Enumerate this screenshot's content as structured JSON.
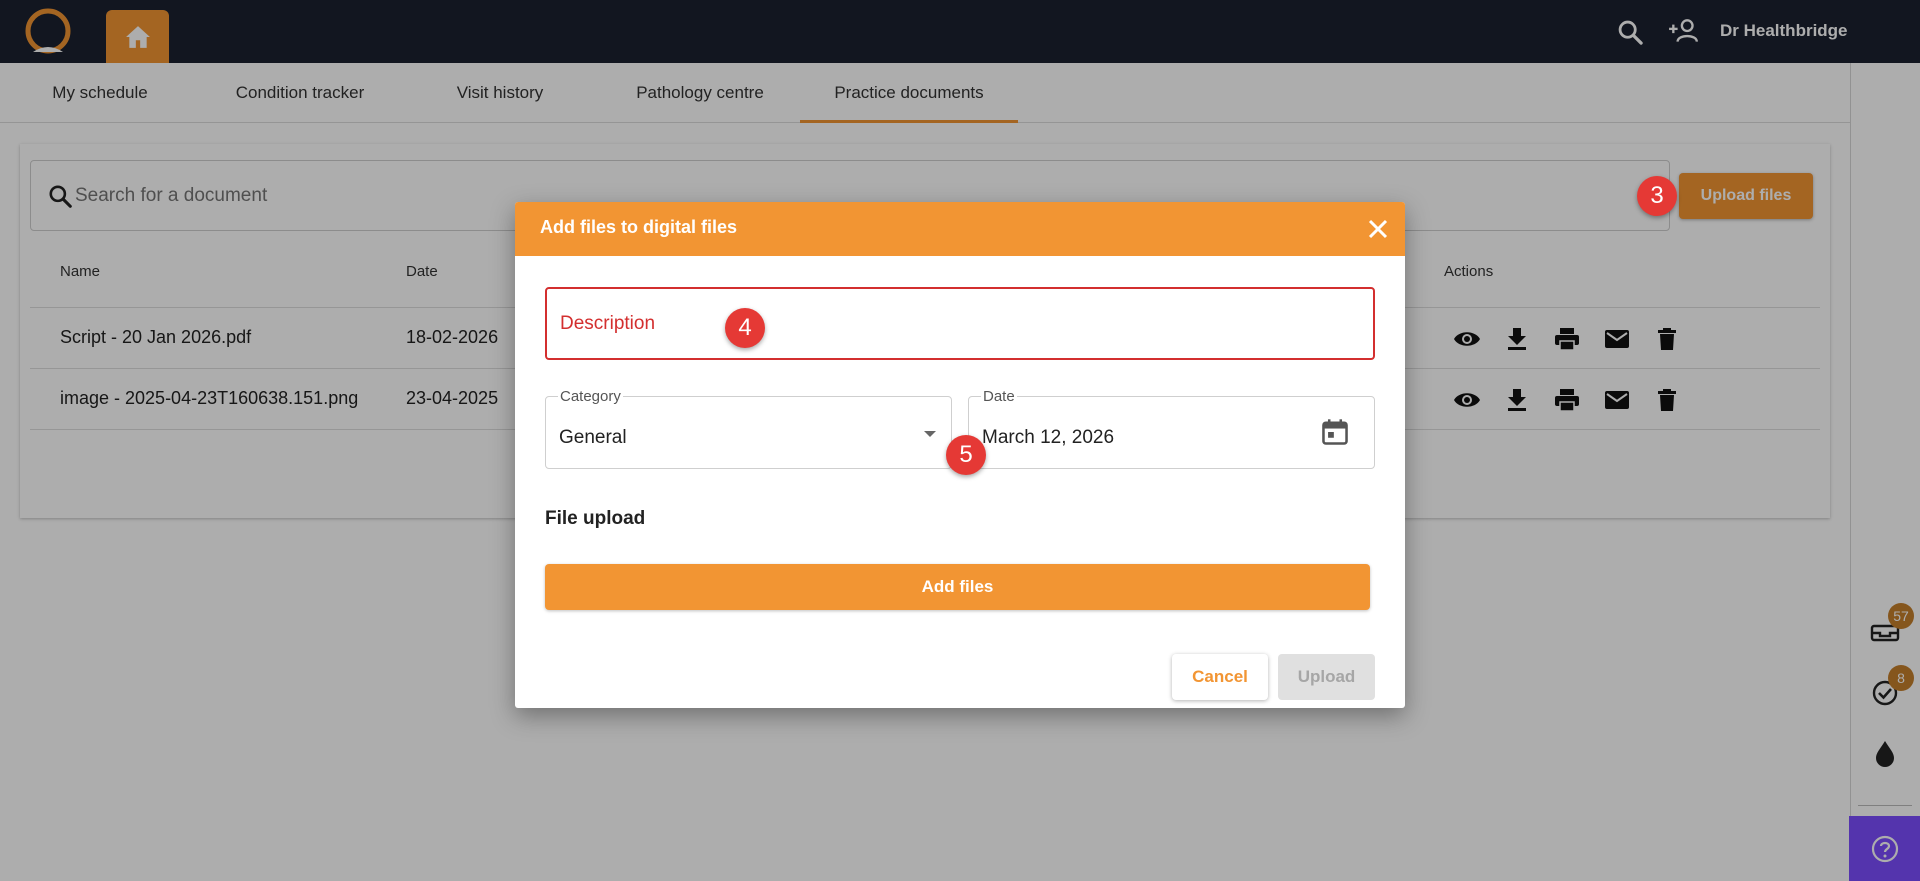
{
  "topbar": {
    "user_name": "Dr Healthbridge",
    "icons": [
      "logo-icon",
      "home-icon",
      "search-icon",
      "add-user-icon"
    ]
  },
  "tabs": [
    {
      "label": "My schedule",
      "active": false
    },
    {
      "label": "Condition tracker",
      "active": false
    },
    {
      "label": "Visit history",
      "active": false
    },
    {
      "label": "Pathology centre",
      "active": false
    },
    {
      "label": "Practice documents",
      "active": true
    }
  ],
  "search": {
    "placeholder": "Search for a document",
    "value": ""
  },
  "toolbar": {
    "upload_files_label": "Upload files"
  },
  "table": {
    "columns": [
      "Name",
      "Date",
      "Actions"
    ],
    "rows": [
      {
        "name": "Script - 20 Jan 2026.pdf",
        "date": "18-02-2026"
      },
      {
        "name": "image - 2025-04-23T160638.151.png",
        "date": "23-04-2025"
      }
    ],
    "action_icons": [
      "view-icon",
      "download-icon",
      "print-icon",
      "email-icon",
      "delete-icon"
    ]
  },
  "sidebar": {
    "badges": [
      {
        "icon": "inbox-icon",
        "count": "57"
      },
      {
        "icon": "tasks-icon",
        "count": "8"
      },
      {
        "icon": "drop-icon",
        "count": ""
      }
    ],
    "help_icon": "help-icon"
  },
  "step_markers": {
    "upload_files": "3",
    "description": "4",
    "category_date": "5"
  },
  "dialog": {
    "title": "Add files to digital files",
    "description_placeholder": "Description",
    "category_label": "Category",
    "category_value": "General",
    "date_label": "Date",
    "date_value": "March 12, 2026",
    "file_upload_label": "File upload",
    "add_files_label": "Add files",
    "cancel_label": "Cancel",
    "upload_label": "Upload"
  },
  "colors": {
    "accent": "#f29533",
    "topbar": "#1b2130",
    "error": "#d32f2f",
    "step_marker": "#e53935",
    "help": "#7c4dff"
  }
}
